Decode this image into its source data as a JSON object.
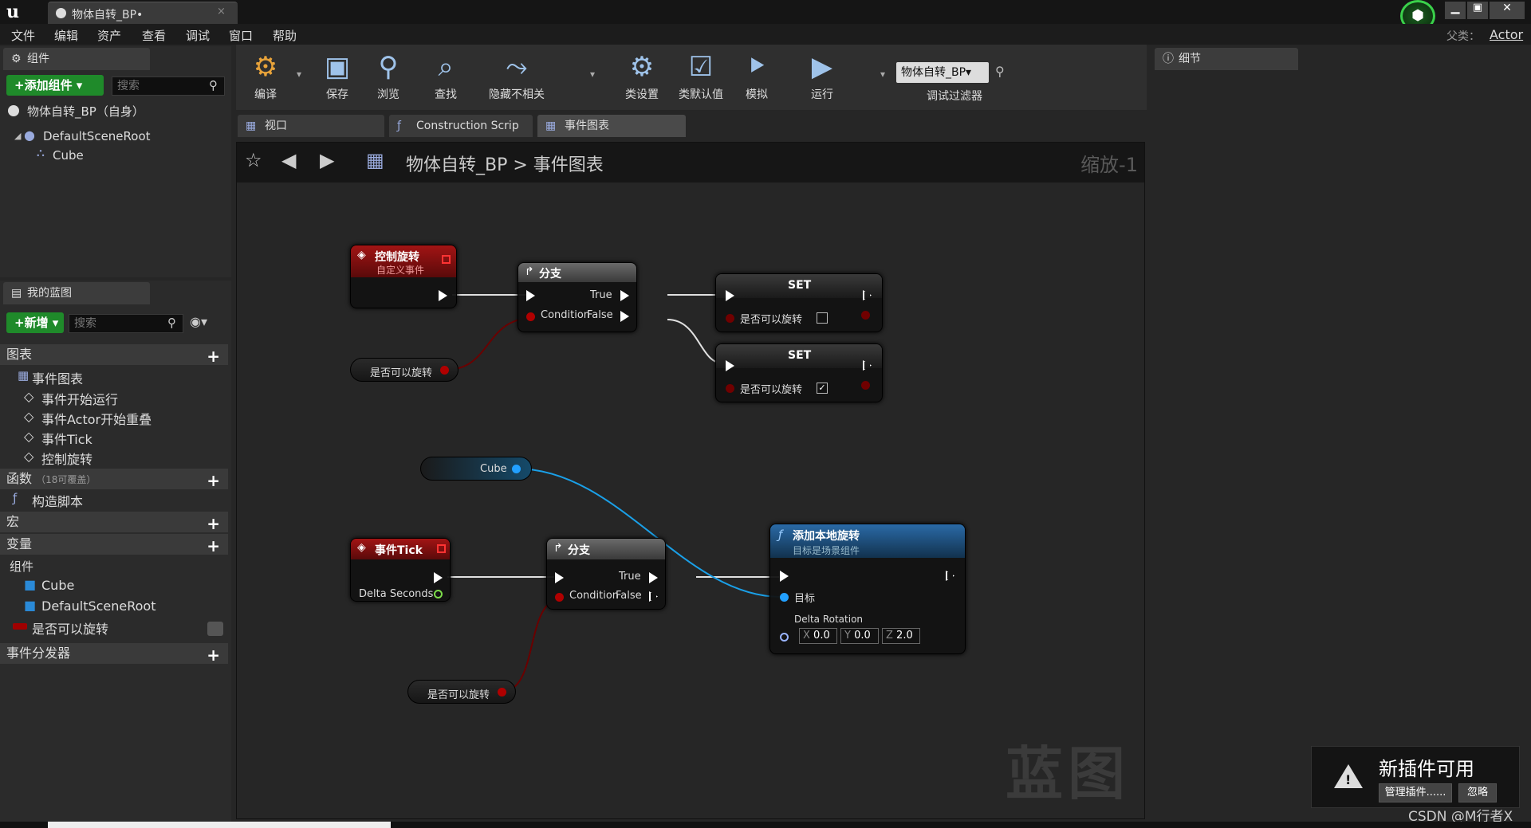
{
  "window": {
    "tab_title": "物体自转_BP•",
    "tab_close": "×",
    "minimize": "▁",
    "maximize": "▣",
    "close": "✕",
    "badge_icon": "ue-launcher-icon"
  },
  "menu": {
    "items": [
      "文件",
      "编辑",
      "资产",
      "查看",
      "调试",
      "窗口",
      "帮助"
    ],
    "parent_label": "父类：",
    "parent_value": "Actor"
  },
  "components_panel": {
    "tab": "组件",
    "add_button": "+添加组件 ▾",
    "search_placeholder": "搜索",
    "self_item": "物体自转_BP（自身）",
    "tree": [
      "DefaultSceneRoot",
      "Cube"
    ]
  },
  "my_blueprint": {
    "tab": "我的蓝图",
    "new_button": "+新增 ▾",
    "search_placeholder": "搜索",
    "sections": {
      "graphs": "图表",
      "event_graph": "事件图表",
      "events": [
        "事件开始运行",
        "事件Actor开始重叠",
        "事件Tick",
        "控制旋转"
      ],
      "functions": "函数",
      "functions_note": "（18可覆盖）",
      "construction": "构造脚本",
      "macros": "宏",
      "variables": "变量",
      "components_group": "组件",
      "component_vars": [
        "Cube",
        "DefaultSceneRoot"
      ],
      "bool_var": "是否可以旋转",
      "dispatchers": "事件分发器"
    }
  },
  "toolbar": {
    "buttons": [
      {
        "label": "编译",
        "icon": "compile-icon"
      },
      {
        "label": "保存",
        "icon": "save-icon"
      },
      {
        "label": "浏览",
        "icon": "browse-icon"
      },
      {
        "label": "查找",
        "icon": "find-icon"
      },
      {
        "label": "隐藏不相关",
        "icon": "hide-unrelated-icon"
      },
      {
        "label": "类设置",
        "icon": "class-settings-icon"
      },
      {
        "label": "类默认值",
        "icon": "class-defaults-icon"
      },
      {
        "label": "模拟",
        "icon": "simulate-icon"
      },
      {
        "label": "运行",
        "icon": "play-icon"
      }
    ],
    "debug_select": "物体自转_BP▾",
    "debug_filter_label": "调试过滤器"
  },
  "details_panel": {
    "tab": "细节"
  },
  "editor_tabs": [
    "视口",
    "Construction Scrip",
    "事件图表"
  ],
  "graph": {
    "breadcrumb": "物体自转_BP > 事件图表",
    "zoom": "缩放-1",
    "watermark": "蓝图",
    "nodes": {
      "custom_event": {
        "title": "控制旋转",
        "subtitle": "自定义事件"
      },
      "branch1": {
        "title": "分支",
        "condition": "Condition",
        "true": "True",
        "false": "False"
      },
      "set1": {
        "title": "SET",
        "var": "是否可以旋转",
        "checked": false
      },
      "set2": {
        "title": "SET",
        "var": "是否可以旋转",
        "checked": true
      },
      "get1": {
        "label": "是否可以旋转"
      },
      "cube_ref": {
        "label": "Cube"
      },
      "tick": {
        "title": "事件Tick",
        "delta": "Delta Seconds"
      },
      "branch2": {
        "title": "分支",
        "condition": "Condition",
        "true": "True",
        "false": "False"
      },
      "get2": {
        "label": "是否可以旋转"
      },
      "add_rot": {
        "title": "添加本地旋转",
        "subtitle": "目标是场景组件",
        "target": "目标",
        "delta": "Delta Rotation",
        "x_label": "X",
        "x": "0.0",
        "y_label": "Y",
        "y": "0.0",
        "z_label": "Z",
        "z": "2.0"
      }
    }
  },
  "toast": {
    "title": "新插件可用",
    "manage": "管理插件......",
    "ignore": "忽略"
  },
  "footer_credit": "CSDN @M行者X",
  "colors": {
    "event_red": "#8a1010",
    "branch_gray": "#5a5a5a",
    "func_blue": "#1f5f9a",
    "exec_wire": "#e0e0e0",
    "bool_wire": "#6a0000",
    "object_wire": "#1aa0e8"
  }
}
